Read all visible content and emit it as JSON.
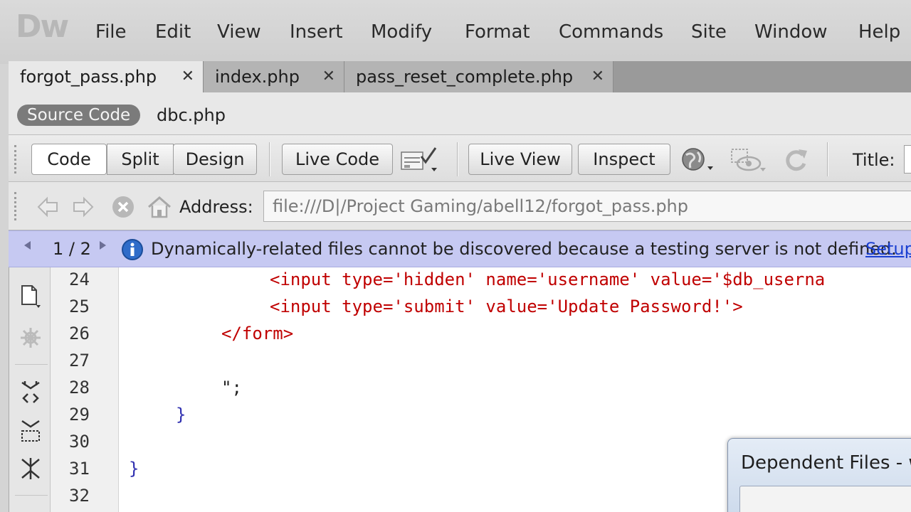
{
  "app": {
    "logo": "Dw"
  },
  "menu": [
    "File",
    "Edit",
    "View",
    "Insert",
    "Modify",
    "Format",
    "Commands",
    "Site",
    "Window",
    "Help"
  ],
  "tabs": [
    {
      "label": "forgot_pass.php",
      "active": true
    },
    {
      "label": "index.php",
      "active": false
    },
    {
      "label": "pass_reset_complete.php",
      "active": false
    }
  ],
  "related_files": {
    "source_code": "Source Code",
    "files": [
      "dbc.php"
    ]
  },
  "doc_toolbar": {
    "views": [
      "Code",
      "Split",
      "Design"
    ],
    "active_view": "Code",
    "live_code": "Live Code",
    "live_view": "Live View",
    "inspect": "Inspect",
    "title_label": "Title:",
    "title_value": ""
  },
  "browser_nav": {
    "address_label": "Address:",
    "address_value": "file:///D|/Project Gaming/abell12/forgot_pass.php"
  },
  "info_bar": {
    "counter": "1 / 2",
    "message": "Dynamically-related files cannot be discovered because a testing server is not defined.",
    "link": "Setup"
  },
  "code": {
    "line_numbers": [
      "24",
      "25",
      "26",
      "27",
      "28",
      "29",
      "30",
      "31",
      "32"
    ],
    "lines": [
      "<input type='hidden' name='username' value='$db_userna",
      "<input type='submit' value='Update Password!'>",
      "</form>",
      "",
      "\";",
      "}",
      "",
      "}",
      ""
    ]
  },
  "dialog": {
    "title": "Dependent Files - w"
  },
  "colors": {
    "accent_link": "#1a3fd1",
    "info_bar_bg": "#c6c9f2",
    "code_tag": "#c00000",
    "code_brace": "#3030b0"
  }
}
